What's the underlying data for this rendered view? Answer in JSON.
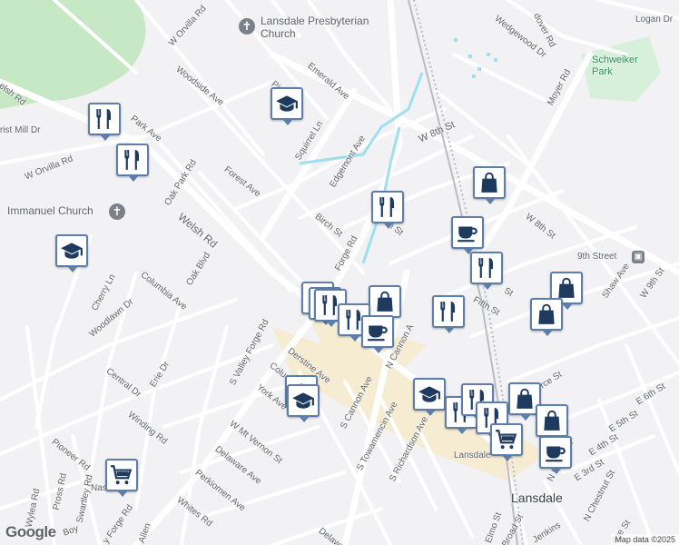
{
  "map": {
    "copyright": "Map data ©2025",
    "logo": "Google",
    "poi_labels": {
      "presbyterian_church": "Lansdale Presbyterian Church",
      "immanuel_church": "Immanuel Church",
      "schweiker_park": "Schweiker Park",
      "station": "9th Street",
      "lansdale_city": "Lansdale",
      "lansdale_small": "Lansdale"
    },
    "streets": {
      "w_orvilla_rd_top": "W Orvilla Rd",
      "woodside_ave": "Woodside Ave",
      "pine_st": "Pine St",
      "emerald_ave": "Emerald Ave",
      "squirrel_ln": "Squirrel Ln",
      "edgemont_ave": "Edgemont Ave",
      "welsh_rd_left": "elsh Rd",
      "christ_mill_dr": "rist Mill Dr",
      "park_ave": "Park Ave",
      "w_orvilla_rd": "W Orvilla Rd",
      "oak_park_rd": "Oak Park Rd",
      "forest_ave": "Forest Ave",
      "welsh_rd": "Welsh Rd",
      "birch_st": "Birch St",
      "forge_rd": "Forge Rd",
      "w_ninth_st": "9th St",
      "w_8th_st_top": "W 8th St",
      "w_8th_st_right": "W 8th St",
      "oak_blvd": "Oak Blvd",
      "columbia_ave": "Columbia Ave",
      "cherry_ln": "Cherry Ln",
      "woodlawn_dr": "Woodlawn Dr",
      "s_valley_forge_rd": "S Valley Forge Rd",
      "derstine_ave": "Derstine Ave",
      "columbia_short": "Colu",
      "york_ave": "York Ave",
      "central_dr": "Central Dr",
      "erie_dr": "Erie Dr",
      "winding_rd": "Winding Rd",
      "w_mt_vernon_st": "W Mt Vernon St",
      "delaware_ave": "Delaware Ave",
      "perkiomen_ave": "Perkiomen Ave",
      "whites_rd": "Whites Rd",
      "pioneer_rd": "Pioneer Rd",
      "pross_rd": "Pross Rd",
      "swartley_rd": "Swartley Rd",
      "nas": "Nas",
      "valley_forge_rd_bottom": "y Forge Rd",
      "n_cannon_ave": "N Cannon A",
      "s_cannon_ave": "S Cannon Ave",
      "s_towamencin_ave": "S Towamencin Ave",
      "s_richardson_ave": "S Richardson Ave",
      "fifth_st": "Fifth St",
      "st_frag": "St",
      "w_9th_st": "W 9th St",
      "shaw_ave": "Shaw Ave",
      "e_6th_st": "E 6th St",
      "e_5th_st": "E 5th St",
      "e_4th_st": "E 4th St",
      "e_3rd_st": "E 3rd St",
      "n_broad_st": "N Broad St",
      "n_chestnut_st": "N Chestnut St",
      "moyer_rd": "Moyer Rd",
      "wedgewood_dr": "Wedgewood Dr",
      "dover_rd": "dover Rd",
      "logan_dr": "Logan Dr",
      "pierce_st": "rce St",
      "elmo_st": "Elmo St",
      "broad_st": "Broad St",
      "jenkins": "Jenkins",
      "delaware_bottom": "Delawar",
      "allen": "Allen",
      "l_boy": "Boy",
      "wylea": "Wylea Rd",
      "ridge_st": "dge St"
    },
    "pins": [
      {
        "type": "restaurant",
        "icon": "fork-knife-icon"
      },
      {
        "type": "restaurant",
        "icon": "fork-knife-icon"
      },
      {
        "type": "school",
        "icon": "graduation-cap-icon"
      },
      {
        "type": "school",
        "icon": "graduation-cap-icon"
      },
      {
        "type": "restaurant",
        "icon": "fork-knife-icon"
      },
      {
        "type": "shopping",
        "icon": "shopping-bag-icon"
      },
      {
        "type": "cafe",
        "icon": "coffee-cup-icon"
      },
      {
        "type": "restaurant",
        "icon": "fork-knife-icon"
      },
      {
        "type": "shopping",
        "icon": "shopping-bag-icon"
      },
      {
        "type": "shopping",
        "icon": "shopping-bag-icon"
      },
      {
        "type": "restaurant",
        "icon": "fork-knife-icon"
      },
      {
        "type": "shopping",
        "icon": "shopping-bag-icon"
      },
      {
        "type": "restaurant",
        "icon": "fork-knife-icon"
      },
      {
        "type": "restaurant",
        "icon": "fork-knife-icon"
      },
      {
        "type": "restaurant",
        "icon": "fork-knife-icon"
      },
      {
        "type": "restaurant",
        "icon": "fork-knife-icon"
      },
      {
        "type": "cafe",
        "icon": "coffee-cup-icon"
      },
      {
        "type": "school",
        "icon": "graduation-cap-icon"
      },
      {
        "type": "school",
        "icon": "graduation-cap-icon"
      },
      {
        "type": "school",
        "icon": "graduation-cap-icon"
      },
      {
        "type": "restaurant",
        "icon": "fork-knife-icon"
      },
      {
        "type": "shopping",
        "icon": "shopping-bag-icon"
      },
      {
        "type": "restaurant",
        "icon": "fork-knife-icon"
      },
      {
        "type": "restaurant",
        "icon": "fork-knife-icon"
      },
      {
        "type": "shopping",
        "icon": "shopping-bag-icon"
      },
      {
        "type": "grocery",
        "icon": "shopping-cart-icon"
      },
      {
        "type": "cafe",
        "icon": "coffee-cup-icon"
      },
      {
        "type": "grocery",
        "icon": "shopping-cart-icon"
      }
    ],
    "colors": {
      "background": "#f2f1f4",
      "road": "#ffffff",
      "water": "#9ee0ee",
      "park": "#d6f0d9",
      "woods": "#c6e8c4",
      "downtown": "#f6ecd2",
      "rail": "#b9bcc2",
      "pin_border": "#5d7ea8",
      "pin_icon": "#1f3a5f"
    }
  }
}
